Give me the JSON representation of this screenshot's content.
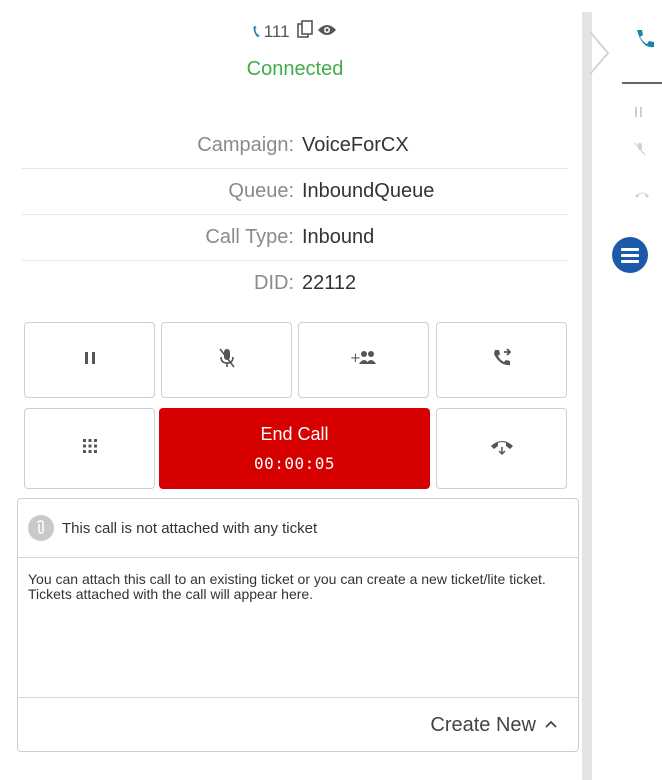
{
  "header": {
    "extension": "111",
    "status": "Connected"
  },
  "call_info": [
    {
      "label": "Campaign:",
      "value": "VoiceForCX"
    },
    {
      "label": "Queue:",
      "value": "InboundQueue"
    },
    {
      "label": "Call Type:",
      "value": "Inbound"
    },
    {
      "label": "DID:",
      "value": "22112"
    }
  ],
  "controls": {
    "end_call_label": "End Call",
    "timer": "00:00:05"
  },
  "ticket": {
    "header_text": "This call is not attached with any ticket",
    "body_text": "You can attach this call to an existing ticket or you can create a new ticket/lite ticket. Tickets attached with the call will appear here.",
    "create_new_label": "Create New"
  },
  "icons": {
    "phone": "phone-icon",
    "copy": "copy-icon",
    "eye": "eye-icon",
    "hold": "pause-icon",
    "mute": "mic-off-icon",
    "conference": "add-participants-icon",
    "transfer": "call-transfer-icon",
    "dialpad": "dialpad-icon",
    "hangup": "hangup-icon",
    "attachment": "paperclip-icon",
    "menu": "hamburger-menu-icon"
  },
  "colors": {
    "connected": "#3fae49",
    "end_call": "#d70000",
    "phone_accent": "#1a86a6",
    "menu_button": "#1b5aa8"
  }
}
